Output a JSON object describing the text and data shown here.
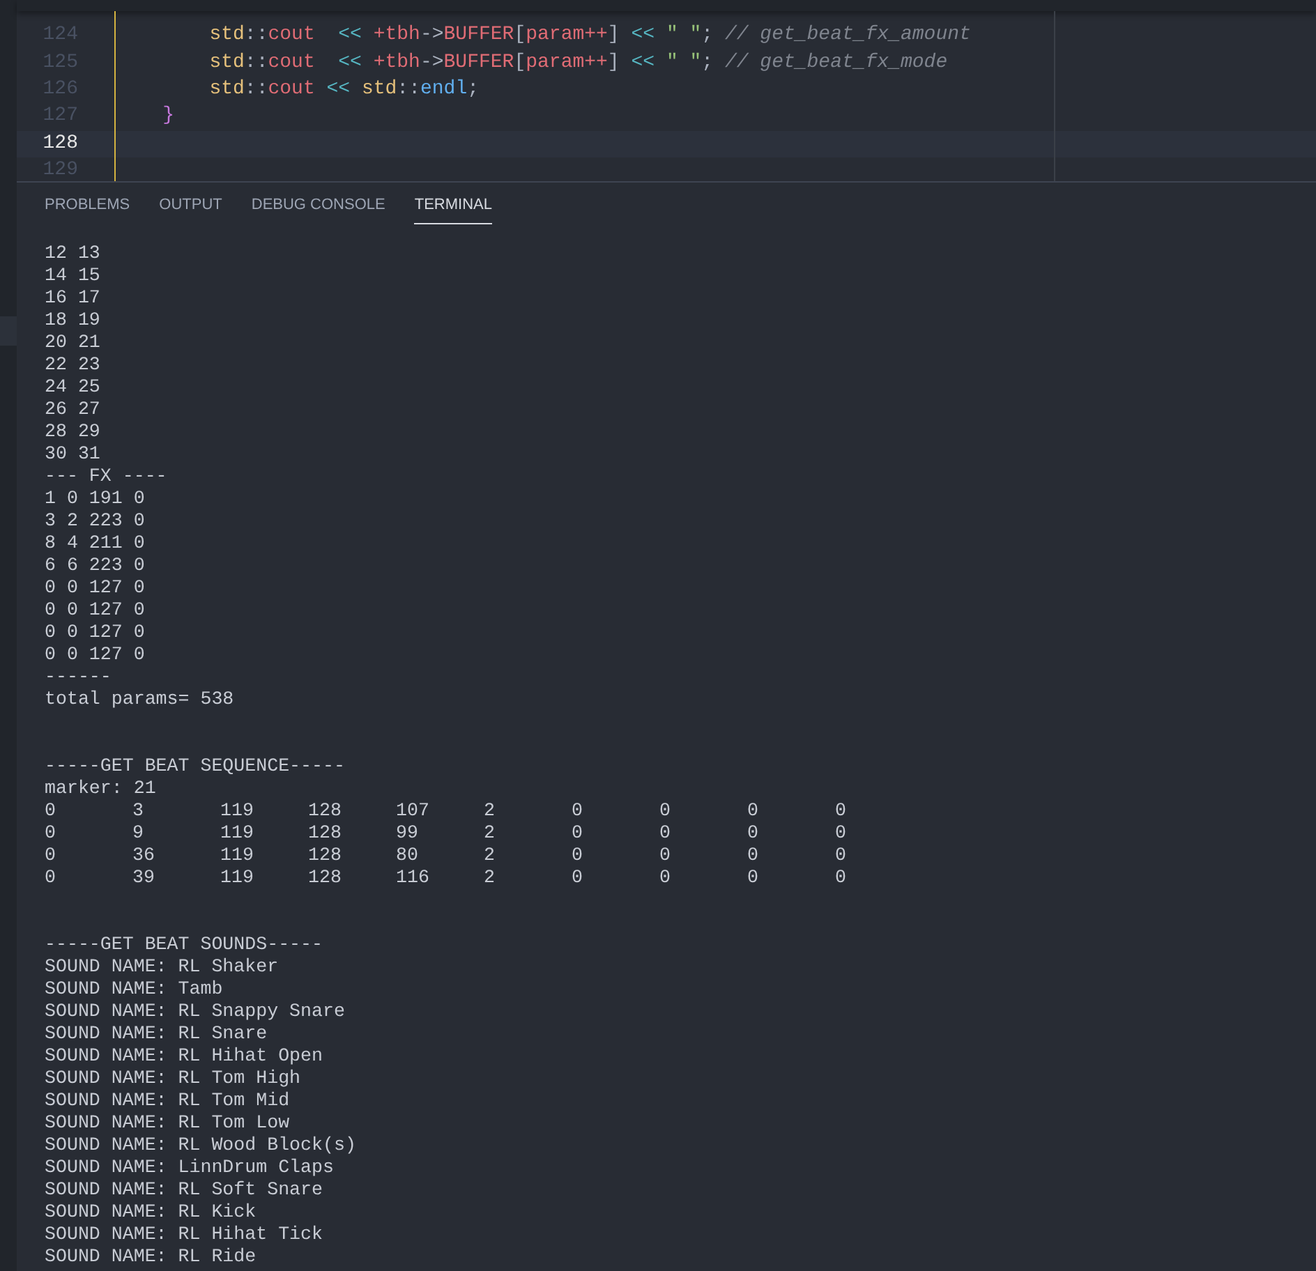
{
  "editor": {
    "lines": [
      {
        "number": "124",
        "current": false,
        "tokens": [
          {
            "kind": "ns",
            "text": "        std"
          },
          {
            "kind": "punct",
            "text": "::"
          },
          {
            "kind": "var",
            "text": "cout"
          },
          {
            "kind": "op",
            "text": "  <<"
          },
          {
            "kind": "var",
            "text": " +tbh"
          },
          {
            "kind": "punct",
            "text": "->"
          },
          {
            "kind": "var",
            "text": "BUFFER"
          },
          {
            "kind": "punct",
            "text": "["
          },
          {
            "kind": "var",
            "text": "param++"
          },
          {
            "kind": "punct",
            "text": "]"
          },
          {
            "kind": "op",
            "text": " <<"
          },
          {
            "kind": "str",
            "text": " \" \""
          },
          {
            "kind": "punct",
            "text": ";"
          },
          {
            "kind": "comment",
            "text": " // get_beat_fx_amount"
          }
        ]
      },
      {
        "number": "125",
        "current": false,
        "tokens": [
          {
            "kind": "ns",
            "text": "        std"
          },
          {
            "kind": "punct",
            "text": "::"
          },
          {
            "kind": "var",
            "text": "cout"
          },
          {
            "kind": "op",
            "text": "  <<"
          },
          {
            "kind": "var",
            "text": " +tbh"
          },
          {
            "kind": "punct",
            "text": "->"
          },
          {
            "kind": "var",
            "text": "BUFFER"
          },
          {
            "kind": "punct",
            "text": "["
          },
          {
            "kind": "var",
            "text": "param++"
          },
          {
            "kind": "punct",
            "text": "]"
          },
          {
            "kind": "op",
            "text": " <<"
          },
          {
            "kind": "str",
            "text": " \" \""
          },
          {
            "kind": "punct",
            "text": ";"
          },
          {
            "kind": "comment",
            "text": " // get_beat_fx_mode"
          }
        ]
      },
      {
        "number": "126",
        "current": false,
        "tokens": [
          {
            "kind": "ns",
            "text": "        std"
          },
          {
            "kind": "punct",
            "text": "::"
          },
          {
            "kind": "var",
            "text": "cout"
          },
          {
            "kind": "op",
            "text": " <<"
          },
          {
            "kind": "ns",
            "text": " std"
          },
          {
            "kind": "punct",
            "text": "::"
          },
          {
            "kind": "fn",
            "text": "endl"
          },
          {
            "kind": "punct",
            "text": ";"
          }
        ]
      },
      {
        "number": "127",
        "current": false,
        "tokens": [
          {
            "kind": "brace",
            "text": "    }"
          }
        ]
      },
      {
        "number": "128",
        "current": true
      },
      {
        "number": "129",
        "current": false
      }
    ]
  },
  "panel": {
    "tabs": [
      {
        "label": "PROBLEMS",
        "selected": false
      },
      {
        "label": "OUTPUT",
        "selected": false
      },
      {
        "label": "DEBUG CONSOLE",
        "selected": false
      },
      {
        "label": "TERMINAL",
        "selected": true
      }
    ]
  },
  "terminal": {
    "lines": [
      {
        "kind": "text",
        "text": "12 13"
      },
      {
        "kind": "text",
        "text": "14 15"
      },
      {
        "kind": "text",
        "text": "16 17"
      },
      {
        "kind": "text",
        "text": "18 19"
      },
      {
        "kind": "text",
        "text": "20 21"
      },
      {
        "kind": "text",
        "text": "22 23"
      },
      {
        "kind": "text",
        "text": "24 25"
      },
      {
        "kind": "text",
        "text": "26 27"
      },
      {
        "kind": "text",
        "text": "28 29"
      },
      {
        "kind": "text",
        "text": "30 31"
      },
      {
        "kind": "text",
        "text": "--- FX ----"
      },
      {
        "kind": "text",
        "text": "1 0 191 0"
      },
      {
        "kind": "text",
        "text": "3 2 223 0"
      },
      {
        "kind": "text",
        "text": "8 4 211 0"
      },
      {
        "kind": "text",
        "text": "6 6 223 0"
      },
      {
        "kind": "text",
        "text": "0 0 127 0"
      },
      {
        "kind": "text",
        "text": "0 0 127 0"
      },
      {
        "kind": "text",
        "text": "0 0 127 0"
      },
      {
        "kind": "text",
        "text": "0 0 127 0"
      },
      {
        "kind": "text",
        "text": "------"
      },
      {
        "kind": "text",
        "text": "total params= 538"
      },
      {
        "kind": "blank"
      },
      {
        "kind": "blank"
      },
      {
        "kind": "text",
        "text": "-----GET BEAT SEQUENCE-----"
      },
      {
        "kind": "text",
        "text": "marker: 21"
      },
      {
        "kind": "row",
        "cells": [
          "0",
          "3",
          "119",
          "128",
          "107",
          "2",
          "0",
          "0",
          "0",
          "0"
        ]
      },
      {
        "kind": "row",
        "cells": [
          "0",
          "9",
          "119",
          "128",
          "99",
          "2",
          "0",
          "0",
          "0",
          "0"
        ]
      },
      {
        "kind": "row",
        "cells": [
          "0",
          "36",
          "119",
          "128",
          "80",
          "2",
          "0",
          "0",
          "0",
          "0"
        ]
      },
      {
        "kind": "row",
        "cells": [
          "0",
          "39",
          "119",
          "128",
          "116",
          "2",
          "0",
          "0",
          "0",
          "0"
        ]
      },
      {
        "kind": "blank"
      },
      {
        "kind": "blank"
      },
      {
        "kind": "text",
        "text": "-----GET BEAT SOUNDS-----"
      },
      {
        "kind": "text",
        "text": "SOUND NAME: RL Shaker"
      },
      {
        "kind": "text",
        "text": "SOUND NAME: Tamb"
      },
      {
        "kind": "text",
        "text": "SOUND NAME: RL Snappy Snare"
      },
      {
        "kind": "text",
        "text": "SOUND NAME: RL Snare"
      },
      {
        "kind": "text",
        "text": "SOUND NAME: RL Hihat Open"
      },
      {
        "kind": "text",
        "text": "SOUND NAME: RL Tom High"
      },
      {
        "kind": "text",
        "text": "SOUND NAME: RL Tom Mid"
      },
      {
        "kind": "text",
        "text": "SOUND NAME: RL Tom Low"
      },
      {
        "kind": "text",
        "text": "SOUND NAME: RL Wood Block(s)"
      },
      {
        "kind": "text",
        "text": "SOUND NAME: LinnDrum Claps"
      },
      {
        "kind": "text",
        "text": "SOUND NAME: RL Soft Snare"
      },
      {
        "kind": "text",
        "text": "SOUND NAME: RL Kick"
      },
      {
        "kind": "text",
        "text": "SOUND NAME: RL Hihat Tick"
      },
      {
        "kind": "text",
        "text": "SOUND NAME: RL Ride"
      }
    ]
  }
}
